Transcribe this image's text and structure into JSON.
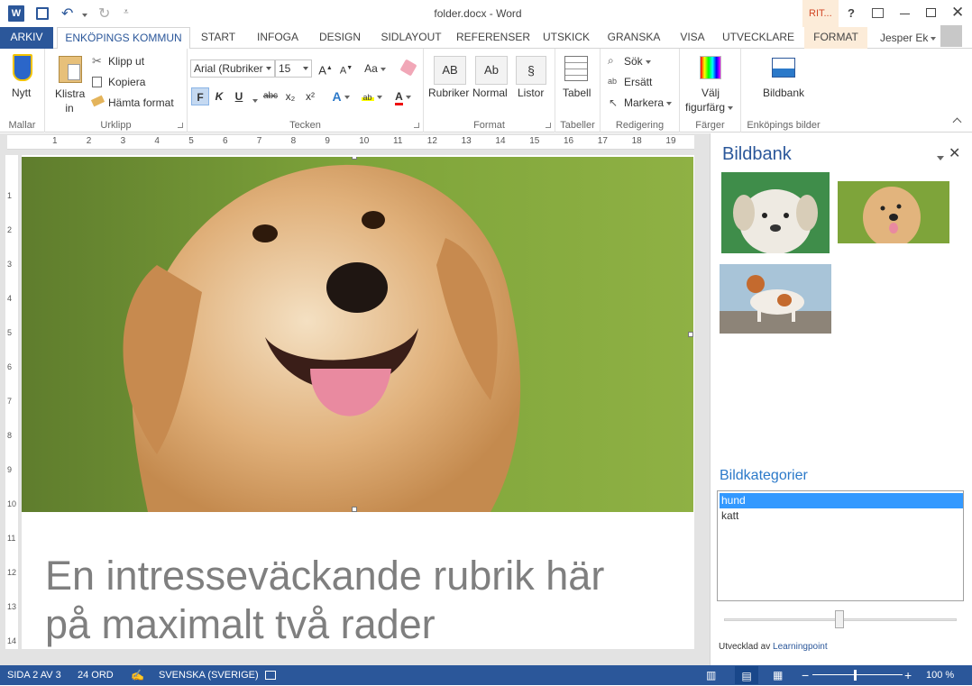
{
  "window": {
    "doc_title": "folder.docx - Word",
    "context_tab": "RIT...",
    "help": "?",
    "user": "Jesper Ek"
  },
  "tabs": [
    {
      "label": "ARKIV"
    },
    {
      "label": "ENKÖPINGS KOMMUN"
    },
    {
      "label": "START"
    },
    {
      "label": "INFOGA"
    },
    {
      "label": "DESIGN"
    },
    {
      "label": "SIDLAYOUT"
    },
    {
      "label": "REFERENSER"
    },
    {
      "label": "UTSKICK"
    },
    {
      "label": "GRANSKA"
    },
    {
      "label": "VISA"
    },
    {
      "label": "UTVECKLARE"
    },
    {
      "label": "FORMAT"
    }
  ],
  "ribbon": {
    "mallar": {
      "new_label": "Nytt",
      "group_label": "Mallar"
    },
    "urklipp": {
      "paste_label": "Klistra in",
      "cut": "Klipp ut",
      "copy": "Kopiera",
      "format_painter": "Hämta format",
      "group_label": "Urklipp"
    },
    "tecken": {
      "font": "Arial (Rubriker",
      "size": "15",
      "bold": "F",
      "italic": "K",
      "underline": "U",
      "strike": "abc",
      "sub": "x₂",
      "sup": "x²",
      "case": "Aa",
      "grow": "A",
      "shrink": "A",
      "group_label": "Tecken"
    },
    "format": {
      "rubriker": "Rubriker",
      "normal": "Normal",
      "listor": "Listor",
      "ab1": "AB",
      "ab2": "Ab",
      "para": "§",
      "group_label": "Format"
    },
    "tabeller": {
      "tabell": "Tabell",
      "group_label": "Tabeller"
    },
    "redigering": {
      "sok": "Sök",
      "ersatt": "Ersätt",
      "markera": "Markera",
      "group_label": "Redigering"
    },
    "farger": {
      "valj": "Välj",
      "figurfarg": "figurfärg",
      "group_label": "Färger"
    },
    "bilder": {
      "bildbank": "Bildbank",
      "group_label": "Enköpings bilder"
    }
  },
  "ruler": {
    "h_ticks": [
      "1",
      "2",
      "3",
      "4",
      "5",
      "6",
      "7",
      "8",
      "9",
      "10",
      "11",
      "12",
      "13",
      "14",
      "15",
      "16",
      "17",
      "18",
      "19"
    ],
    "v_ticks": [
      "1",
      "2",
      "3",
      "4",
      "5",
      "6",
      "7",
      "8",
      "9",
      "10",
      "11",
      "12",
      "13",
      "14"
    ]
  },
  "document": {
    "heading_line1": "En intresseväckande rubrik här",
    "heading_line2": "på maximalt två rader"
  },
  "pane": {
    "title": "Bildbank",
    "categories_label": "Bildkategorier",
    "categories": [
      "hund",
      "katt"
    ],
    "selected_category": "hund",
    "slider_value": 0.5,
    "credit_prefix": "Utvecklad av",
    "credit_link": "Learningpoint"
  },
  "status": {
    "page": "SIDA 2 AV 3",
    "words": "24 ORD",
    "language": "SVENSKA (SVERIGE)",
    "zoom": "100 %",
    "zoom_level": 1.0
  },
  "colors": {
    "accent": "#2b579a",
    "selection": "#3399ff",
    "heading_text": "#7f7f7f"
  }
}
